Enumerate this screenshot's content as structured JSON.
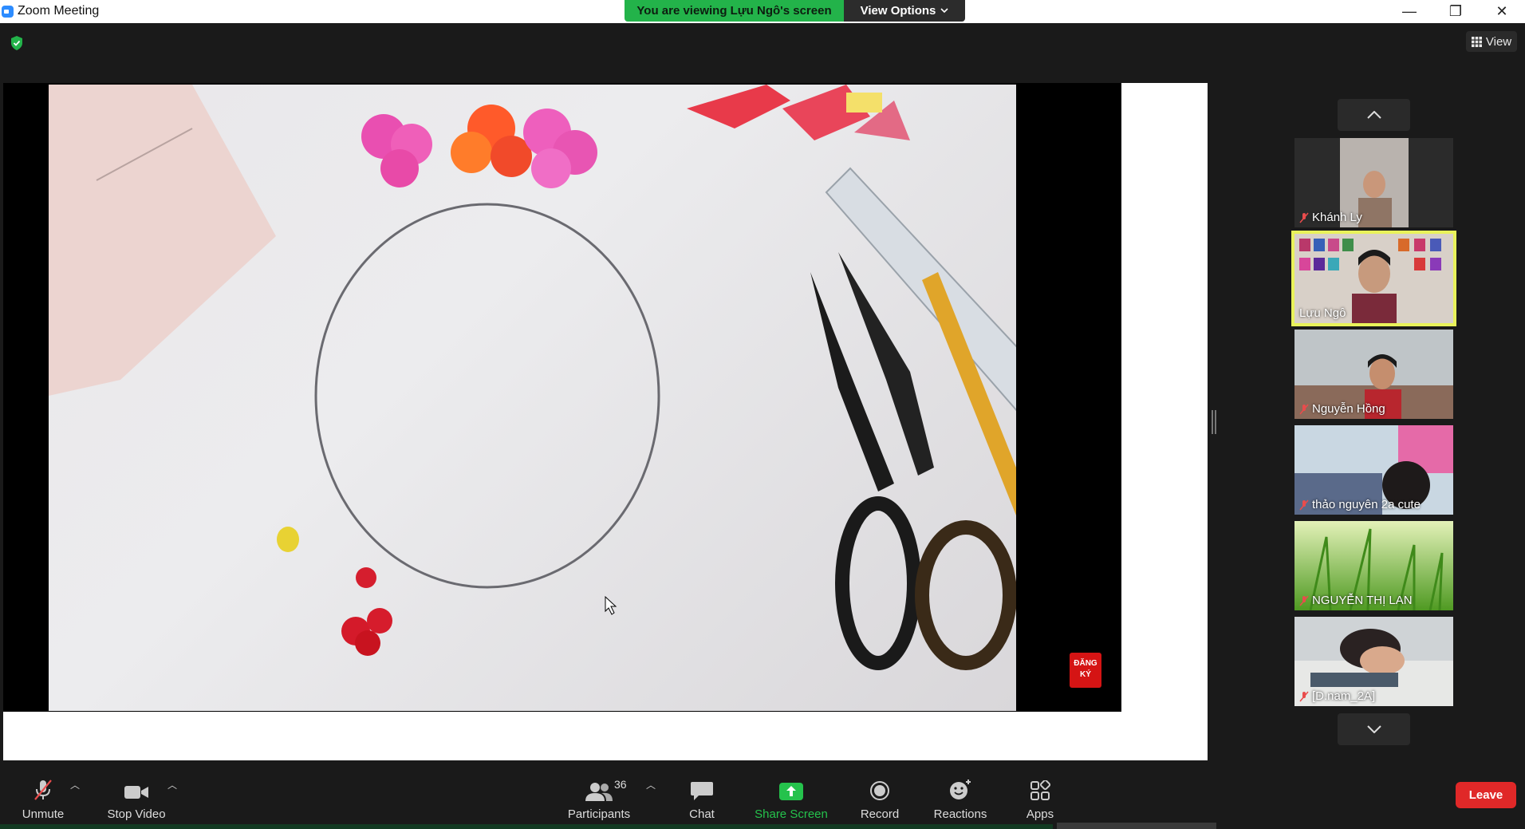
{
  "window": {
    "title": "Zoom Meeting",
    "minimize": "—",
    "maximize": "❐",
    "close": "✕"
  },
  "share_banner": {
    "viewing_text": "You are viewing Lựu Ngô's screen",
    "view_options_label": "View Options"
  },
  "view_button": {
    "label": "View"
  },
  "shared_content": {
    "badge_text": "ĐĂNG KÝ"
  },
  "gallery": {
    "participants": [
      {
        "name": "Khánh Ly",
        "muted": true,
        "active": false
      },
      {
        "name": "Lựu Ngô",
        "muted": false,
        "active": true
      },
      {
        "name": "Nguyễn Hồng",
        "muted": true,
        "active": false
      },
      {
        "name": "thảo nguyên 2a cute",
        "muted": true,
        "active": false
      },
      {
        "name": "NGUYỄN THỊ LAN",
        "muted": true,
        "active": false
      },
      {
        "name": "[D.nam_2A]",
        "muted": true,
        "active": false
      }
    ]
  },
  "toolbar": {
    "unmute": "Unmute",
    "stop_video": "Stop Video",
    "participants": "Participants",
    "participants_count": "36",
    "chat": "Chat",
    "share_screen": "Share Screen",
    "record": "Record",
    "reactions": "Reactions",
    "apps": "Apps",
    "leave": "Leave"
  },
  "colors": {
    "banner_green": "#23b34a",
    "active_speaker": "#e9f25a",
    "leave_red": "#e02828",
    "share_green": "#25c24c"
  }
}
